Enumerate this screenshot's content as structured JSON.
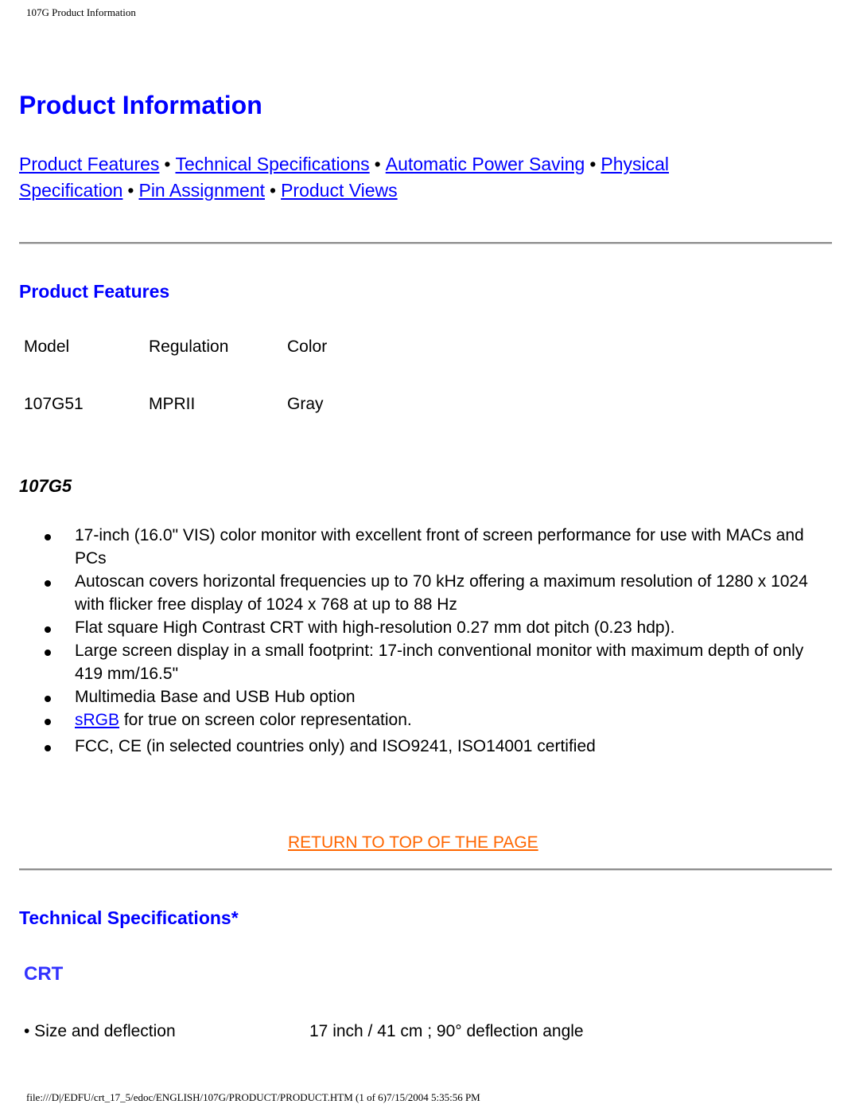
{
  "header": {
    "title": "107G Product Information"
  },
  "page_title": "Product Information",
  "nav": {
    "links": [
      "Product Features",
      "Technical Specifications",
      "Automatic Power Saving",
      "Physical Specification",
      "Pin Assignment",
      "Product Views"
    ],
    "separator": "•"
  },
  "product_features": {
    "title": "Product Features",
    "table": {
      "headers": [
        "Model",
        "Regulation",
        "Color"
      ],
      "rows": [
        [
          "107G51",
          "MPRII",
          "Gray"
        ]
      ]
    },
    "model_heading": "107G5",
    "bullets": [
      "17-inch (16.0\" VIS) color monitor with excellent front of screen performance for use with MACs and PCs",
      "Autoscan covers horizontal frequencies up to 70 kHz offering a maximum resolution of 1280 x 1024 with flicker free display of 1024 x 768 at up to 88 Hz",
      "Flat square High Contrast CRT with high-resolution 0.27 mm dot pitch (0.23 hdp).",
      "Large screen display in a small footprint: 17-inch conventional monitor with maximum depth of only 419 mm/16.5\"",
      "Multimedia Base and USB Hub option",
      {
        "link": "sRGB",
        "text": " for true on screen color representation."
      },
      "FCC, CE (in selected countries only) and ISO9241, ISO14001 certified"
    ],
    "return_link": "RETURN TO TOP OF THE PAGE"
  },
  "technical_specifications": {
    "title": "Technical Specifications*",
    "subsection": "CRT",
    "rows": [
      {
        "label": "• Size and deflection",
        "value": "17 inch / 41 cm ; 90° deflection angle"
      }
    ]
  },
  "footer": {
    "text": "file:///D|/EDFU/crt_17_5/edoc/ENGLISH/107G/PRODUCT/PRODUCT.HTM (1 of 6)7/15/2004 5:35:56 PM"
  },
  "colors": {
    "link": "#0000ff",
    "heading": "#0000ff",
    "crt_heading": "#3333ff",
    "return_link": "#ff6600"
  }
}
